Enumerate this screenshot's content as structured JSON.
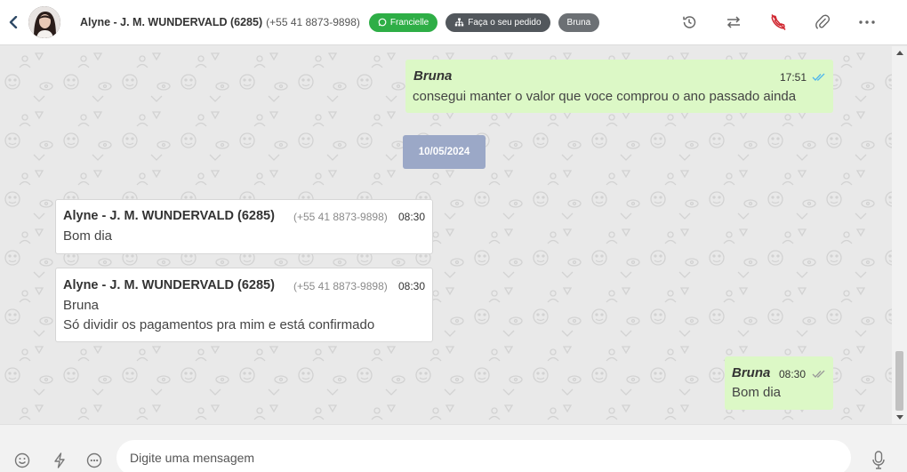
{
  "header": {
    "contact_name": "Alyne - J. M. WUNDERVALD (6285)",
    "contact_phone": "(+55 41 8873-9898)",
    "tags": {
      "whatsapp": "Francielle",
      "order": "Faça o seu pedido",
      "agent": "Bruna"
    },
    "icons": [
      "back-icon",
      "history-icon",
      "transfer-icon",
      "end-call-icon",
      "attach-icon",
      "more-icon"
    ]
  },
  "messages": {
    "m1": {
      "sender": "Bruna",
      "time": "17:51",
      "text": "consegui manter o valor que voce comprou o ano passado ainda",
      "direction": "out",
      "status": "read"
    },
    "date_divider": "10/05/2024",
    "m2": {
      "sender": "Alyne - J. M. WUNDERVALD (6285)",
      "phone": "(+55 41 8873-9898)",
      "time": "08:30",
      "text": "Bom dia",
      "direction": "in"
    },
    "m3": {
      "sender": "Alyne - J. M. WUNDERVALD (6285)",
      "phone": "(+55 41 8873-9898)",
      "time": "08:30",
      "line1": "Bruna",
      "line2": "Só dividir os pagamentos pra mim e está confirmado",
      "direction": "in"
    },
    "m4": {
      "sender": "Bruna",
      "time": "08:30",
      "text": "Bom dia",
      "direction": "out",
      "status": "delivered"
    }
  },
  "composer": {
    "placeholder": "Digite uma mensagem",
    "icons": [
      "emoji-icon",
      "quick-reply-icon",
      "chat-options-icon",
      "microphone-icon"
    ]
  },
  "colors": {
    "outgoing_bubble": "#dcf8c6",
    "incoming_bubble": "#ffffff",
    "whatsapp_tag": "#2eae46",
    "end_call": "#d0262f",
    "date_chip": "#9ba8c7",
    "read_tick": "#4fb6ec"
  }
}
